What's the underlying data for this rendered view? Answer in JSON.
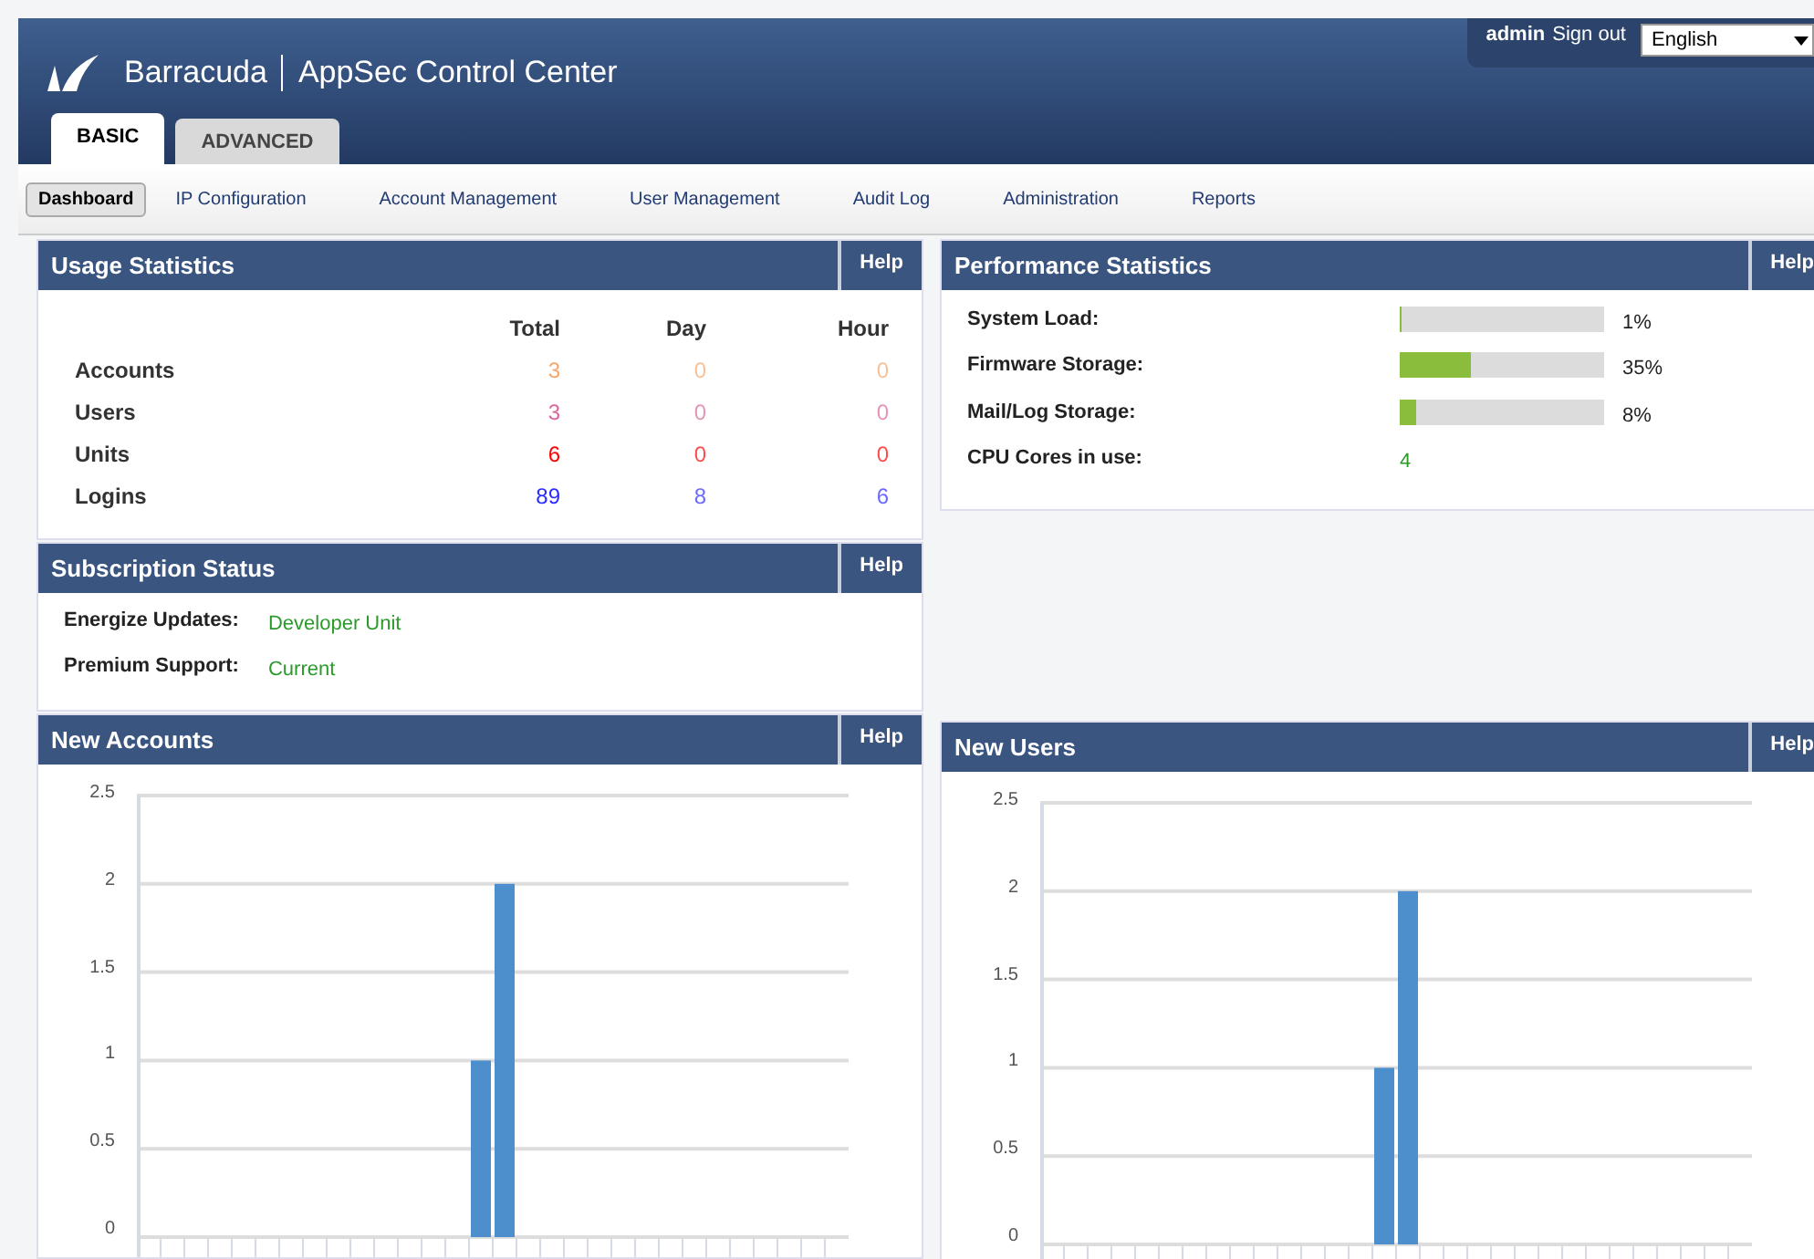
{
  "header": {
    "brand": "Barracuda",
    "product": "AppSec Control Center",
    "user": "admin",
    "sign_out": "Sign out",
    "language": "English"
  },
  "tabs": [
    {
      "label": "BASIC",
      "selected": true
    },
    {
      "label": "ADVANCED",
      "selected": false
    }
  ],
  "nav": [
    {
      "label": "Dashboard",
      "selected": true
    },
    {
      "label": "IP Configuration",
      "selected": false
    },
    {
      "label": "Account Management",
      "selected": false
    },
    {
      "label": "User Management",
      "selected": false
    },
    {
      "label": "Audit Log",
      "selected": false
    },
    {
      "label": "Administration",
      "selected": false
    },
    {
      "label": "Reports",
      "selected": false
    }
  ],
  "usage": {
    "title": "Usage Statistics",
    "help": "Help",
    "columns": [
      "Total",
      "Day",
      "Hour"
    ],
    "rows": [
      {
        "label": "Accounts",
        "color": "#f5a66b",
        "values": [
          "3",
          "0",
          "0"
        ]
      },
      {
        "label": "Users",
        "color": "#d9669c",
        "values": [
          "3",
          "0",
          "0"
        ]
      },
      {
        "label": "Units",
        "color": "#ff0000",
        "values": [
          "6",
          "0",
          "0"
        ]
      },
      {
        "label": "Logins",
        "color": "#2b2bff",
        "values": [
          "89",
          "8",
          "6"
        ]
      }
    ]
  },
  "subscription": {
    "title": "Subscription Status",
    "help": "Help",
    "rows": [
      {
        "label": "Energize Updates:",
        "value": "Developer Unit"
      },
      {
        "label": "Premium Support:",
        "value": "Current"
      }
    ]
  },
  "performance": {
    "title": "Performance Statistics",
    "help": "Help",
    "rows": [
      {
        "kind": "bar",
        "label": "System Load:",
        "level": 0.01,
        "reading": "1%"
      },
      {
        "kind": "bar",
        "label": "Firmware Storage:",
        "level": 0.35,
        "reading": "35%"
      },
      {
        "kind": "bar",
        "label": "Mail/Log Storage:",
        "level": 0.08,
        "reading": "8%"
      },
      {
        "kind": "text",
        "label": "CPU Cores in use:",
        "reading": "4"
      }
    ]
  },
  "charts": [
    {
      "title": "New Accounts",
      "help": "Help",
      "chart_data": {
        "type": "bar",
        "grid": true,
        "ylim": [
          0,
          2.5
        ],
        "yticks": [
          0,
          0.5,
          1,
          1.5,
          2,
          2.5
        ],
        "series": [
          {
            "color": "#4d8fcc",
            "values": [
              0,
              0,
              0,
              0,
              0,
              0,
              0,
              0,
              0,
              0,
              0,
              0,
              0,
              0,
              1,
              2,
              0,
              0,
              0,
              0,
              0,
              0,
              0,
              0,
              0,
              0,
              0,
              0,
              0,
              0
            ]
          }
        ]
      }
    },
    {
      "title": "New Users",
      "help": "Help",
      "chart_data": {
        "type": "bar",
        "grid": true,
        "ylim": [
          0,
          2.5
        ],
        "yticks": [
          0,
          0.5,
          1,
          1.5,
          2,
          2.5
        ],
        "series": [
          {
            "color": "#4d8fcc",
            "values": [
              0,
              0,
              0,
              0,
              0,
              0,
              0,
              0,
              0,
              0,
              0,
              0,
              0,
              0,
              1,
              2,
              0,
              0,
              0,
              0,
              0,
              0,
              0,
              0,
              0,
              0,
              0,
              0,
              0,
              0
            ]
          }
        ]
      }
    }
  ]
}
